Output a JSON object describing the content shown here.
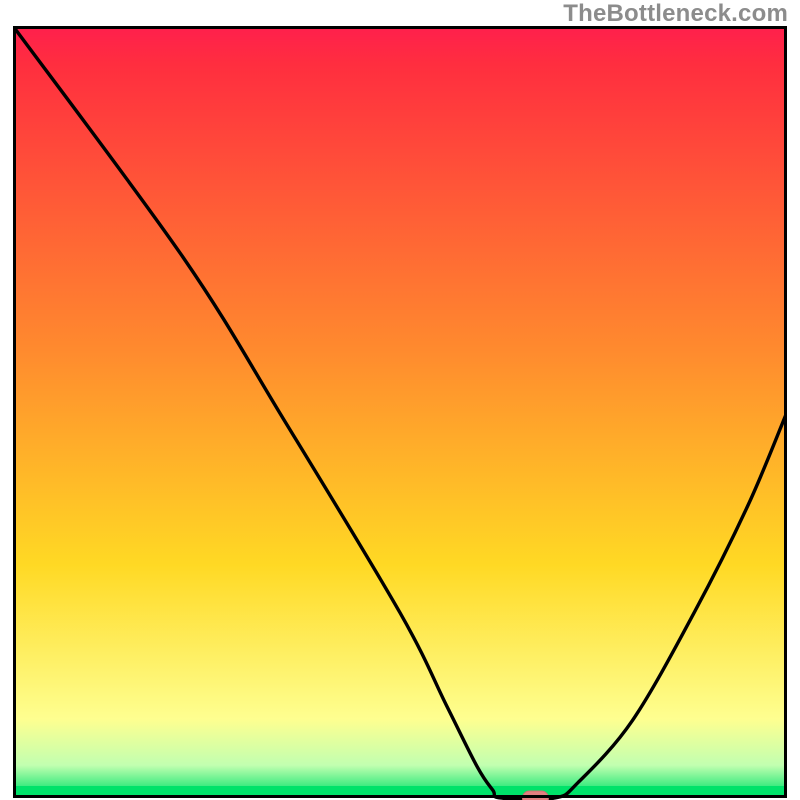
{
  "watermark": "TheBottleneck.com",
  "colors": {
    "top": "#ff1f4d",
    "red": "#ff2e3f",
    "orange": "#ff8a2e",
    "yellow": "#ffd924",
    "pale_yellow": "#feff90",
    "pale_green": "#c2ffb0",
    "green": "#00e26a",
    "border": "#000000",
    "curve": "#000000",
    "marker_fill": "#e28080",
    "marker_stroke": "#cc6e6e"
  },
  "chart_data": {
    "type": "line",
    "title": "",
    "xlabel": "",
    "ylabel": "",
    "xlim": [
      0,
      100
    ],
    "ylim": [
      0,
      100
    ],
    "annotations": [],
    "curve": [
      {
        "x": 0.0,
        "y": 100.0
      },
      {
        "x": 22.0,
        "y": 70.0
      },
      {
        "x": 35.0,
        "y": 49.0
      },
      {
        "x": 50.0,
        "y": 24.0
      },
      {
        "x": 56.0,
        "y": 12.0
      },
      {
        "x": 60.0,
        "y": 4.0
      },
      {
        "x": 62.0,
        "y": 1.0
      },
      {
        "x": 63.0,
        "y": 0.0
      },
      {
        "x": 70.0,
        "y": 0.0
      },
      {
        "x": 73.0,
        "y": 2.0
      },
      {
        "x": 80.0,
        "y": 10.0
      },
      {
        "x": 88.0,
        "y": 24.0
      },
      {
        "x": 95.0,
        "y": 38.0
      },
      {
        "x": 100.0,
        "y": 50.0
      }
    ],
    "marker": {
      "x": 67.5,
      "y": 0.0
    },
    "gradient_stops": [
      {
        "offset": 0.0,
        "key": "top"
      },
      {
        "offset": 0.05,
        "key": "red"
      },
      {
        "offset": 0.42,
        "key": "orange"
      },
      {
        "offset": 0.7,
        "key": "yellow"
      },
      {
        "offset": 0.9,
        "key": "pale_yellow"
      },
      {
        "offset": 0.96,
        "key": "pale_green"
      },
      {
        "offset": 1.0,
        "key": "green"
      }
    ]
  }
}
